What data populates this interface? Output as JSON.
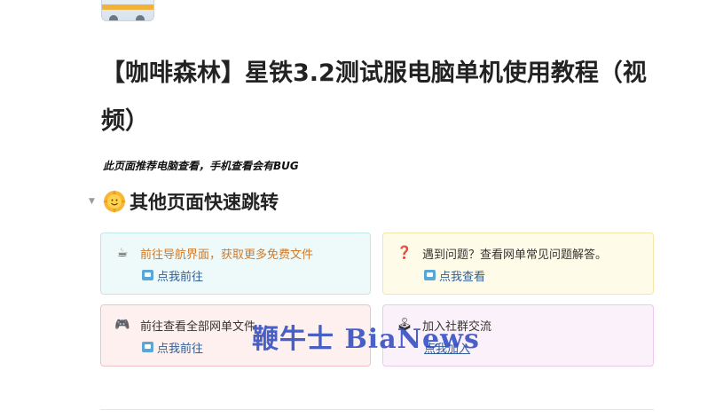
{
  "page": {
    "title": "【咖啡森林】星铁3.2测试服电脑单机使用教程（视频）",
    "subtitle": "此页面推荐电脑查看，手机查看会有BUG"
  },
  "section": {
    "heading": "其他页面快速跳转",
    "heading_icon": "sun-face-icon"
  },
  "cards": [
    {
      "icon": "☕",
      "icon_name": "coffee-icon",
      "text": "前往导航界面，获取更多免费文件",
      "link": "点我前往"
    },
    {
      "icon": "❓",
      "icon_name": "question-icon",
      "text": "遇到问题？查看网单常见问题解答。",
      "link": "点我查看"
    },
    {
      "icon": "🎮",
      "icon_name": "gamepad-icon",
      "text": "前往查看全部网单文件",
      "link": "点我前往"
    },
    {
      "icon": "🕹",
      "icon_name": "joystick-icon",
      "text": "加入社群交流",
      "link": "点我加入"
    }
  ],
  "watermark": "鞭牛士 BiaNews",
  "colors": {
    "accent_link": "#2f5e95",
    "card_teal_bg": "#eefaf9",
    "card_yellow_bg": "#fefbe9",
    "card_red_bg": "#fdf0ef",
    "card_purple_bg": "#fbf1fb",
    "watermark": "#2846be"
  }
}
